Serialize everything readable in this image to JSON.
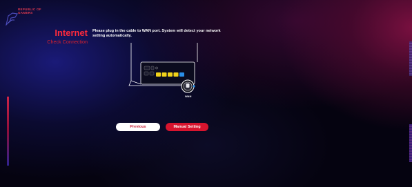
{
  "brand": {
    "logo_line1": "REPUBLIC OF",
    "logo_line2": "GAMERS"
  },
  "page": {
    "title": "Internet",
    "subtitle": "Check Connection",
    "instructions": "Please plug in the cable to WAN port. System will detect your network setting automatically."
  },
  "illustration": {
    "wan_label": "WAN",
    "port_colors": [
      "#f2d21a",
      "#f2d21a",
      "#f2d21a",
      "#f2d21a",
      "#2a8fe8"
    ]
  },
  "buttons": {
    "previous": "Previous",
    "manual": "Manual Setting"
  },
  "colors": {
    "accent": "#e0192f",
    "title": "#ff2a3c",
    "background": "#050310"
  }
}
